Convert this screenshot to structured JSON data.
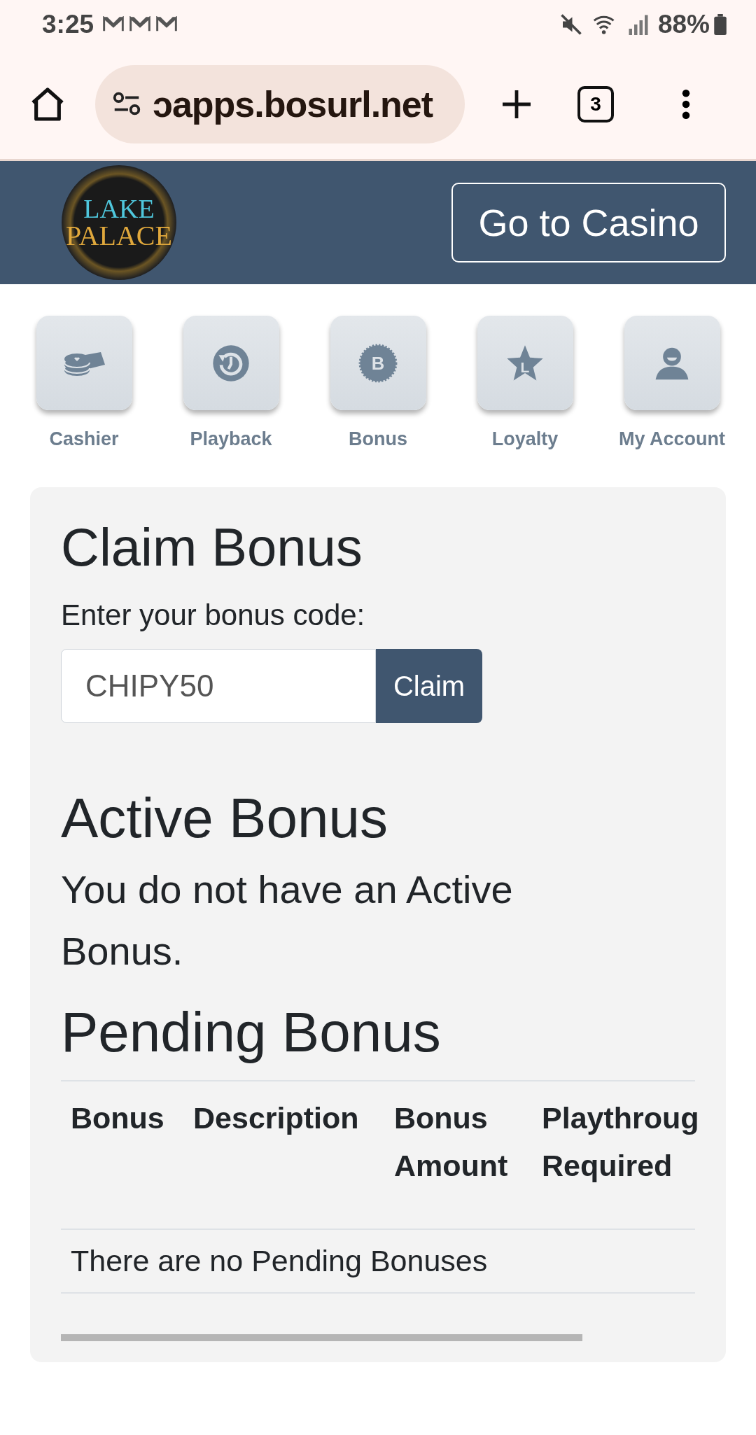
{
  "status_bar": {
    "time": "3:25",
    "battery": "88%"
  },
  "browser": {
    "url": "ɔapps.bosurl.net",
    "tab_count": "3"
  },
  "header": {
    "logo_lines": [
      "LAKE",
      "PALACE"
    ],
    "casino_button": "Go to Casino"
  },
  "nav": [
    {
      "kind": "cashier",
      "label": "Cashier"
    },
    {
      "kind": "playback",
      "label": "Playback"
    },
    {
      "kind": "bonus",
      "label": "Bonus",
      "glyph": "B"
    },
    {
      "kind": "loyalty",
      "label": "Loyalty",
      "glyph": "L"
    },
    {
      "kind": "account",
      "label": "My Account"
    }
  ],
  "claim": {
    "title": "Claim Bonus",
    "label": "Enter your bonus code:",
    "code": "CHIPY50",
    "button": "Claim"
  },
  "active": {
    "title": "Active Bonus",
    "message": "You do not have an Active Bonus."
  },
  "pending": {
    "title": "Pending Bonus",
    "columns": [
      "Bonus",
      "Description",
      "Bonus Amount",
      "Playthroug Required"
    ],
    "empty_message": "There are no Pending Bonuses"
  }
}
